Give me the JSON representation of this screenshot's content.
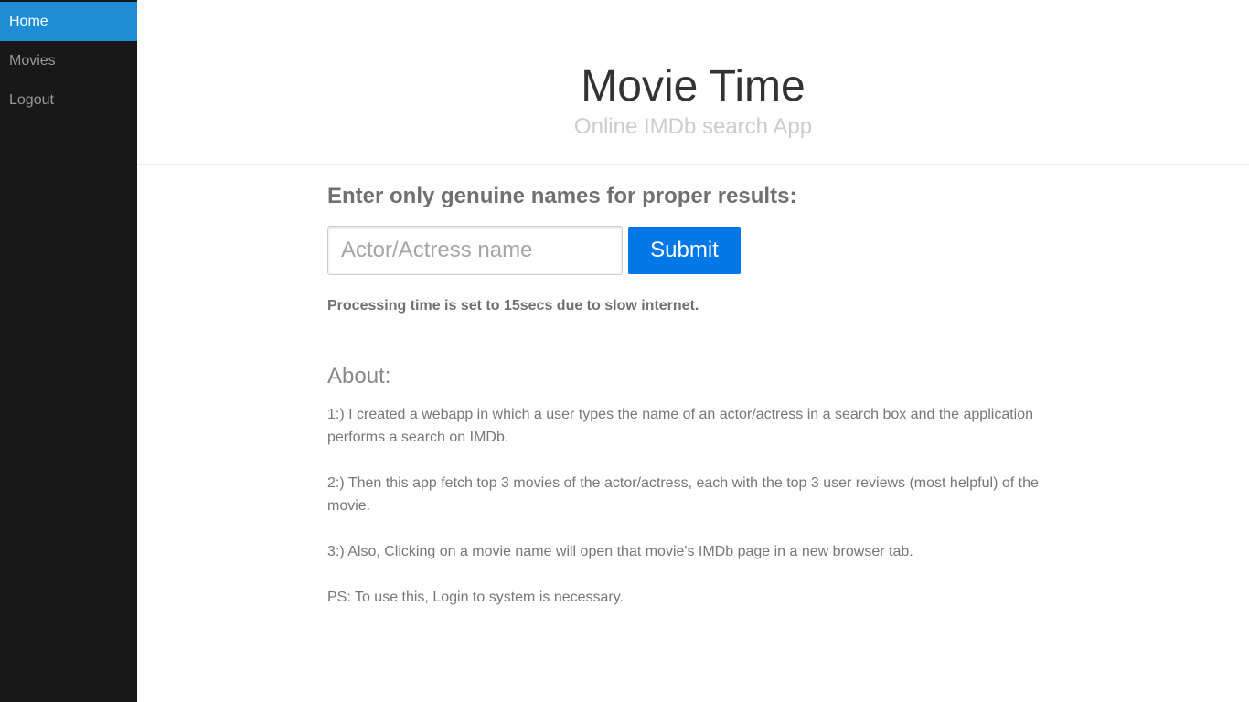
{
  "sidebar": {
    "items": [
      {
        "label": "Home",
        "active": true
      },
      {
        "label": "Movies",
        "active": false
      },
      {
        "label": "Logout",
        "active": false
      }
    ]
  },
  "header": {
    "title": "Movie Time",
    "subtitle": "Online IMDb search App"
  },
  "search": {
    "prompt": "Enter only genuine names for proper results:",
    "placeholder": "Actor/Actress name",
    "value": "",
    "submit_label": "Submit",
    "note": "Processing time is set to 15secs due to slow internet."
  },
  "about": {
    "title": "About:",
    "paragraphs": [
      "1:) I created a webapp in which a user types the name of an actor/actress in a search box and the application performs a search on IMDb.",
      "2:) Then this app fetch top 3 movies of the actor/actress, each with the top 3 user reviews (most helpful) of the movie.",
      "3:) Also, Clicking on a movie name will open that movie's IMDb page in a new browser tab.",
      "PS: To use this, Login to system is necessary."
    ]
  },
  "colors": {
    "sidebar_bg": "#191818",
    "active_nav": "#1f8dd6",
    "submit_button": "#0078e7"
  }
}
